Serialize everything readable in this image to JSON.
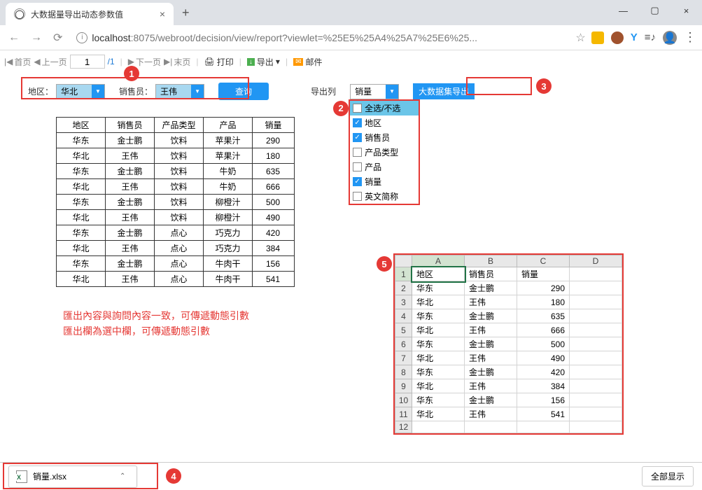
{
  "tab_title": "大数据量导出动态参数值",
  "url_host": "localhost",
  "url_port": ":8075",
  "url_path": "/webroot/decision/view/report?viewlet=%25E5%25A4%25A7%25E6%25...",
  "toolbar": {
    "first": "首页",
    "prev": "上一页",
    "page": "1",
    "total": "/1",
    "next": "下一页",
    "last": "末页",
    "print": "打印",
    "export": "导出",
    "mail": "邮件"
  },
  "form": {
    "region_label": "地区：",
    "region_value": "华北",
    "sales_label": "销售员：",
    "sales_value": "王伟",
    "query_btn": "查询",
    "export_col_label": "导出列",
    "export_col_value": "销量",
    "big_export_btn": "大数据集导出"
  },
  "dropdown": {
    "select_all": "全选/不选",
    "items": [
      {
        "label": "地区",
        "checked": true
      },
      {
        "label": "销售员",
        "checked": true
      },
      {
        "label": "产品类型",
        "checked": false
      },
      {
        "label": "产品",
        "checked": false
      },
      {
        "label": "销量",
        "checked": true
      },
      {
        "label": "英文简称",
        "checked": false
      }
    ]
  },
  "table": {
    "headers": [
      "地区",
      "销售员",
      "产品类型",
      "产品",
      "销量"
    ],
    "rows": [
      [
        "华东",
        "金士鹏",
        "饮料",
        "苹果汁",
        "290"
      ],
      [
        "华北",
        "王伟",
        "饮料",
        "苹果汁",
        "180"
      ],
      [
        "华东",
        "金士鹏",
        "饮料",
        "牛奶",
        "635"
      ],
      [
        "华北",
        "王伟",
        "饮料",
        "牛奶",
        "666"
      ],
      [
        "华东",
        "金士鹏",
        "饮料",
        "柳橙汁",
        "500"
      ],
      [
        "华北",
        "王伟",
        "饮料",
        "柳橙汁",
        "490"
      ],
      [
        "华东",
        "金士鹏",
        "点心",
        "巧克力",
        "420"
      ],
      [
        "华北",
        "王伟",
        "点心",
        "巧克力",
        "384"
      ],
      [
        "华东",
        "金士鹏",
        "点心",
        "牛肉干",
        "156"
      ],
      [
        "华北",
        "王伟",
        "点心",
        "牛肉干",
        "541"
      ]
    ]
  },
  "note_line1": "匯出內容與詢問內容一致，可傳遞動態引數",
  "note_line2": "匯出欄為選中欄，可傳遞動態引數",
  "excel": {
    "cols": [
      "A",
      "B",
      "C",
      "D"
    ],
    "rows": [
      [
        "地区",
        "销售员",
        "销量",
        ""
      ],
      [
        "华东",
        "金士鹏",
        "290",
        ""
      ],
      [
        "华北",
        "王伟",
        "180",
        ""
      ],
      [
        "华东",
        "金士鹏",
        "635",
        ""
      ],
      [
        "华北",
        "王伟",
        "666",
        ""
      ],
      [
        "华东",
        "金士鹏",
        "500",
        ""
      ],
      [
        "华北",
        "王伟",
        "490",
        ""
      ],
      [
        "华东",
        "金士鹏",
        "420",
        ""
      ],
      [
        "华北",
        "王伟",
        "384",
        ""
      ],
      [
        "华东",
        "金士鹏",
        "156",
        ""
      ],
      [
        "华北",
        "王伟",
        "541",
        ""
      ],
      [
        "",
        "",
        "",
        ""
      ]
    ]
  },
  "download_name": "销量.xlsx",
  "show_all": "全部显示",
  "badges": {
    "b1": "1",
    "b2": "2",
    "b3": "3",
    "b4": "4",
    "b5": "5"
  }
}
